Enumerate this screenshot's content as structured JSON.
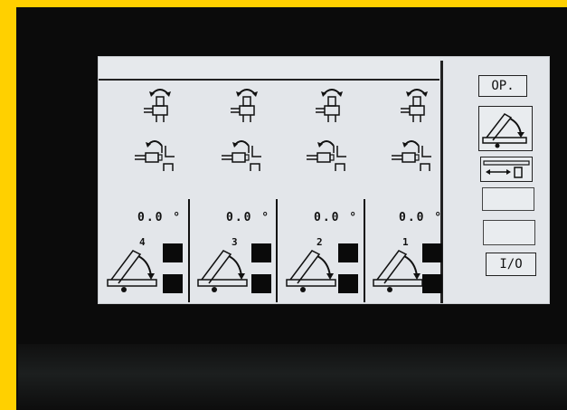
{
  "buttons": {
    "op_label": "OP.",
    "io_label": "I/O"
  },
  "stations": [
    {
      "number": "4",
      "angle": "0.0 °"
    },
    {
      "number": "3",
      "angle": "0.0 °"
    },
    {
      "number": "2",
      "angle": "0.0 °"
    },
    {
      "number": "1",
      "angle": "0.0 °"
    }
  ],
  "icons": {
    "clamp_up": "clamp-open-arrow-icon",
    "clamp_side": "clamp-side-arrow-icon",
    "bend": "bend-angle-icon",
    "slide": "slide-position-icon"
  },
  "colors": {
    "frame": "#ffd000",
    "bezel": "#0b0b0b",
    "screen": "#e3e6ea",
    "ink": "#111111"
  }
}
